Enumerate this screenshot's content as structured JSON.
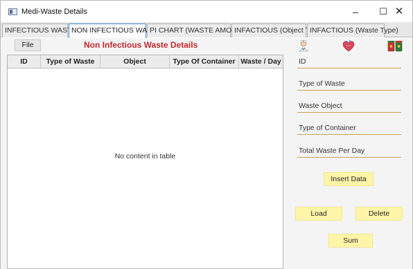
{
  "window": {
    "title": "Medi-Waste Details",
    "minimize_glyph": "–",
    "maximize_glyph": "☐",
    "close_glyph": "✕"
  },
  "tabs": [
    {
      "label": "INFECTIOUS WASTE",
      "active": false
    },
    {
      "label": "NON INFECTIOUS WASTE",
      "active": true
    },
    {
      "label": "PI CHART (WASTE AMOUNT)",
      "active": false
    },
    {
      "label": "INFACTIOUS (Object Type)",
      "active": false
    },
    {
      "label": "INFACTIOUS (Waste Type)",
      "active": false
    }
  ],
  "toolbar": {
    "file_label": "File",
    "panel_title": "Non Infectious Waste Details"
  },
  "table": {
    "columns": [
      "ID",
      "Type of Waste",
      "Object",
      "Type Of Container",
      "Waste / Day"
    ],
    "empty_message": "No content in table"
  },
  "icons": {
    "doctor": "doctor-icon",
    "heart": "heart-organ-icon",
    "bins": "waste-bins-icon"
  },
  "form": {
    "fields": [
      "ID",
      "Type of Waste",
      "Waste Object",
      "Type of Container",
      "Total Waste Per Day"
    ],
    "insert_label": "Insert Data",
    "load_label": "Load",
    "delete_label": "Delete",
    "sum_label": "Sum"
  },
  "colors": {
    "title_red": "#c1272d",
    "button_yellow": "#fff5a9",
    "field_underline": "#c7a15a",
    "active_tab_border": "#3c8fd4"
  }
}
